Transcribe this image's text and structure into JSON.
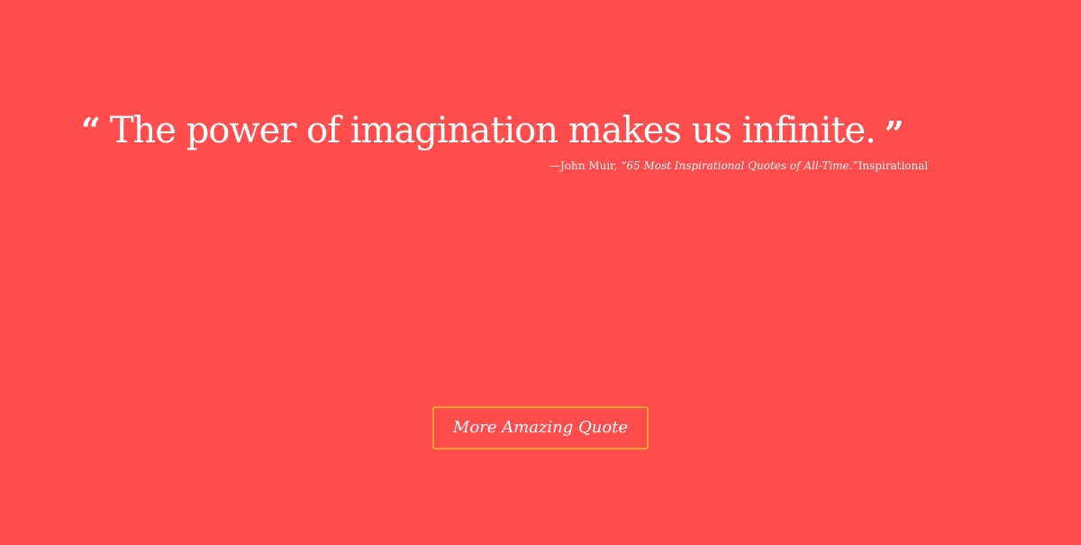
{
  "quote": {
    "open_mark": "“",
    "text": "The power of imagination makes us infinite.",
    "close_mark": "”"
  },
  "attribution": {
    "prefix": "—John Muir, ",
    "source": "“65 Most Inspirational Quotes of All-Time.”",
    "suffix": "Inspirational"
  },
  "button": {
    "label": "More Amazing Quote"
  },
  "colors": {
    "background": "#FF4D4D",
    "text": "#FFFFFF",
    "button_border": "#F5A623"
  }
}
